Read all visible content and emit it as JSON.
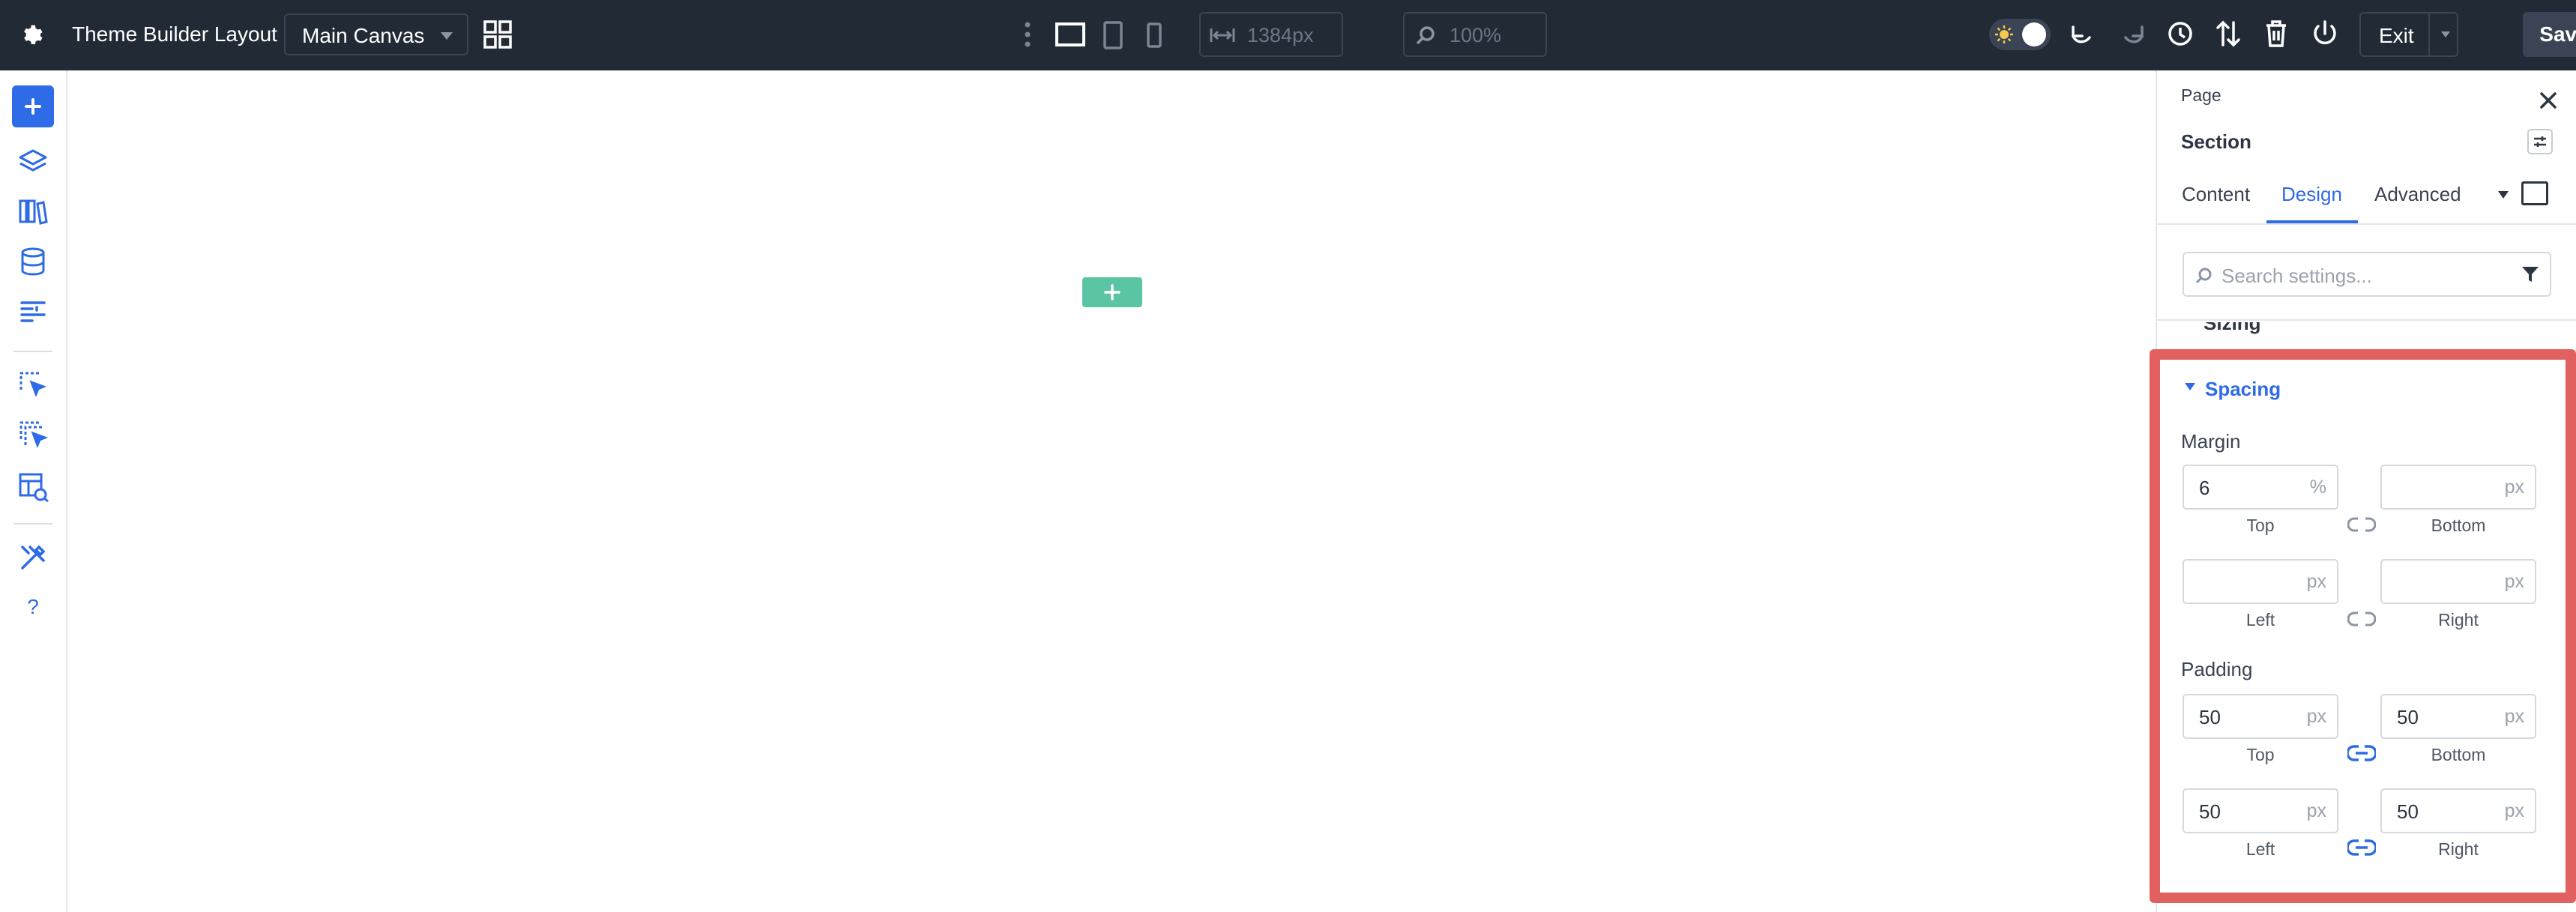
{
  "topbar": {
    "title": "Theme Builder Layout",
    "canvas_select": "Main Canvas",
    "width_value": "1384px",
    "zoom_value": "100%",
    "exit_label": "Exit",
    "save_label": "Save"
  },
  "panel": {
    "breadcrumb": "Page",
    "element_title": "Section",
    "tabs": [
      "Content",
      "Design",
      "Advanced"
    ],
    "active_tab": "Design",
    "search_placeholder": "Search settings...",
    "collapsed_group": "Sizing",
    "spacing": {
      "title": "Spacing",
      "margin": {
        "label": "Margin",
        "top": {
          "value": "6",
          "unit": "%",
          "label": "Top"
        },
        "bottom": {
          "value": "",
          "unit": "px",
          "label": "Bottom"
        },
        "left": {
          "value": "",
          "unit": "px",
          "label": "Left"
        },
        "right": {
          "value": "",
          "unit": "px",
          "label": "Right"
        }
      },
      "padding": {
        "label": "Padding",
        "top": {
          "value": "50",
          "unit": "px",
          "label": "Top"
        },
        "bottom": {
          "value": "50",
          "unit": "px",
          "label": "Bottom"
        },
        "left": {
          "value": "50",
          "unit": "px",
          "label": "Left"
        },
        "right": {
          "value": "50",
          "unit": "px",
          "label": "Right"
        }
      }
    }
  },
  "colors": {
    "topbar_bg": "#222a36",
    "accent_blue": "#2e6be6",
    "add_green": "#5bc4a4",
    "highlight_red": "#e0615f"
  },
  "icons": {
    "settings": "gear-icon",
    "layout": "grid-layout-icon",
    "desktop": "desktop-icon",
    "tablet": "tablet-icon",
    "phone": "phone-icon",
    "undo": "undo-icon",
    "redo": "redo-icon",
    "history": "clock-icon",
    "portability": "arrows-updown-icon",
    "trash": "trash-icon",
    "power": "power-icon"
  }
}
